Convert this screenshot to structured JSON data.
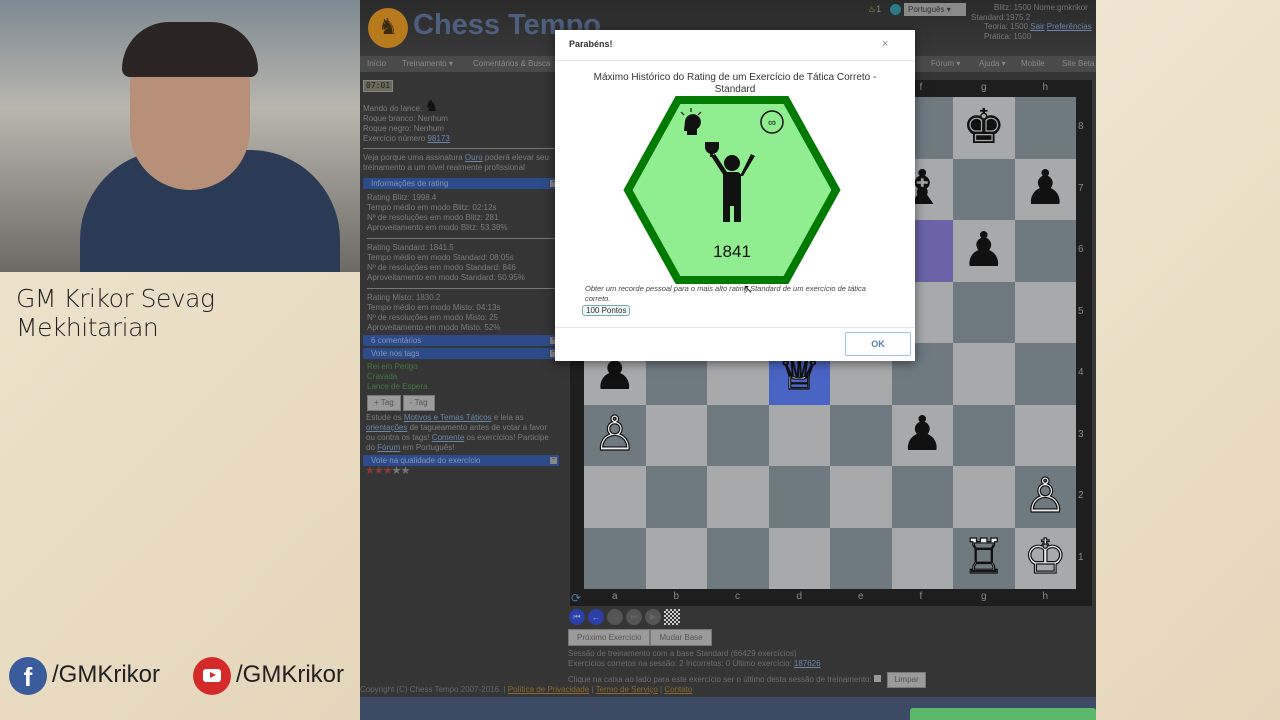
{
  "streamer": {
    "name": "GM Krikor Sevag Mekhitarian",
    "facebook": "/GMKrikor",
    "youtube": "/GMKrikor"
  },
  "header": {
    "logo": "Chess Tempo",
    "logo_ct": "C T",
    "notifications": "1",
    "language": "Português",
    "ratings": [
      {
        "label": "Blitz:",
        "value": "1500"
      },
      {
        "label": "Standard:",
        "value": "1975.2"
      },
      {
        "label": "Teoria:",
        "value": "1500"
      },
      {
        "label": "Prática:",
        "value": "1500"
      }
    ],
    "user": "Nome:gmkrikor",
    "logout": "Sair",
    "prefs": "Preferências"
  },
  "menu": [
    "Início",
    "Treinamento ▾",
    "Comentários & Busca",
    "Fórum ▾",
    "Ajuda ▾",
    "Mobile",
    "Site Beta"
  ],
  "info": {
    "timer": "07:01",
    "to_move": "Mando do lance:",
    "castle_white": "Roque branco: Nenhum",
    "castle_black": "Roque negro: Nenhum",
    "exercise_label": "Exercício número",
    "exercise_num": "98173",
    "promo_a": "Veja porque uma assinatura",
    "promo_link": "Ouro",
    "promo_b": "poderá elevar seu treinamento a um nível realmente profissional"
  },
  "rating_section": {
    "title": "Informações de rating",
    "lines": [
      "Rating Blitz: 1998.4",
      "Tempo médio em modo Blitz: 02:12s",
      "Nº de resoluções em modo Blitz: 281",
      "Aproveitamento em modo Blitz: 53.38%",
      "Rating Standard: 1841.5",
      "Tempo médio em modo Standard: 08:05s",
      "Nº de resoluções em modo Standard: 846",
      "Aproveitamento em modo Standard: 50.95%",
      "Rating Misto: 1830.2",
      "Tempo médio em modo Misto: 04:13s",
      "Nº de resoluções em modo Misto: 25",
      "Aproveitamento em modo Misto: 52%"
    ]
  },
  "comments_section": "6 comentários",
  "tags_section": {
    "title": "Vote nos tags",
    "tags": [
      "Rei em Perigo",
      "Cravada",
      "Lance de Espera"
    ],
    "add": "+ Tag",
    "remove": "- Tag",
    "help": [
      "Estude os",
      "Motivos e Temas Táticos",
      "e leia as",
      "orientações",
      "de tagueamento antes de votar a favor ou contra os tags!",
      "Comente",
      "os exercícios! Participe do",
      "Fórum",
      "em Português!"
    ]
  },
  "quality_section": {
    "title": "Vote na qualidade do exercício",
    "stars": 3,
    "max": 5
  },
  "board": {
    "files": [
      "a",
      "b",
      "c",
      "d",
      "e",
      "f",
      "g",
      "h"
    ],
    "ranks": [
      "8",
      "7",
      "6",
      "5",
      "4",
      "3",
      "2",
      "1"
    ],
    "pieces": [
      {
        "sq": "g8",
        "p": "♚",
        "c": "b"
      },
      {
        "sq": "f7",
        "p": "♝",
        "c": "b"
      },
      {
        "sq": "h7",
        "p": "♟",
        "c": "b"
      },
      {
        "sq": "g6",
        "p": "♟",
        "c": "b"
      },
      {
        "sq": "a4",
        "p": "♟",
        "c": "b"
      },
      {
        "sq": "d4",
        "p": "♕",
        "c": "w"
      },
      {
        "sq": "a3",
        "p": "♙",
        "c": "w"
      },
      {
        "sq": "f3",
        "p": "♟",
        "c": "b"
      },
      {
        "sq": "h2",
        "p": "♙",
        "c": "w"
      },
      {
        "sq": "g1",
        "p": "♖",
        "c": "w"
      },
      {
        "sq": "h1",
        "p": "♔",
        "c": "w"
      }
    ],
    "highlights": [
      {
        "sq": "f6",
        "color": "#6a63a8"
      },
      {
        "sq": "d4",
        "color": "#4a64c4"
      }
    ]
  },
  "controls": {
    "next": "Próximo Exercício",
    "change_base": "Mudar Base",
    "session": "Sessão de treinamento com a base Standard (66429 exercícios)",
    "correct": "Exercícios corretos na sessão: 2  Incorretos: 0  Último exercício:",
    "last_ex": "187626",
    "last_prompt": "Clique na caixa ao lado para este exercício ser o último desta sessão de treinamento:",
    "clear": "Limpar"
  },
  "footer": {
    "copyright": "Copyright (C) Chess Tempo 2007-2016. |",
    "privacy": "Política de Privacidade",
    "terms": "Termo de Serviço",
    "contact": "Contato"
  },
  "modal": {
    "title": "Parabéns!",
    "close": "×",
    "heading": "Máximo Histórico do Rating de um Exercício de Tática Correto - Standard",
    "badge_value": "1841",
    "description": "Obter um recorde pessoal para o mais alto rating Standard de um exercício de tática correto.",
    "points": "100 Pontos",
    "ok": "OK",
    "badge_colors": {
      "fill": "#90ee90",
      "stroke": "#007a00"
    }
  }
}
